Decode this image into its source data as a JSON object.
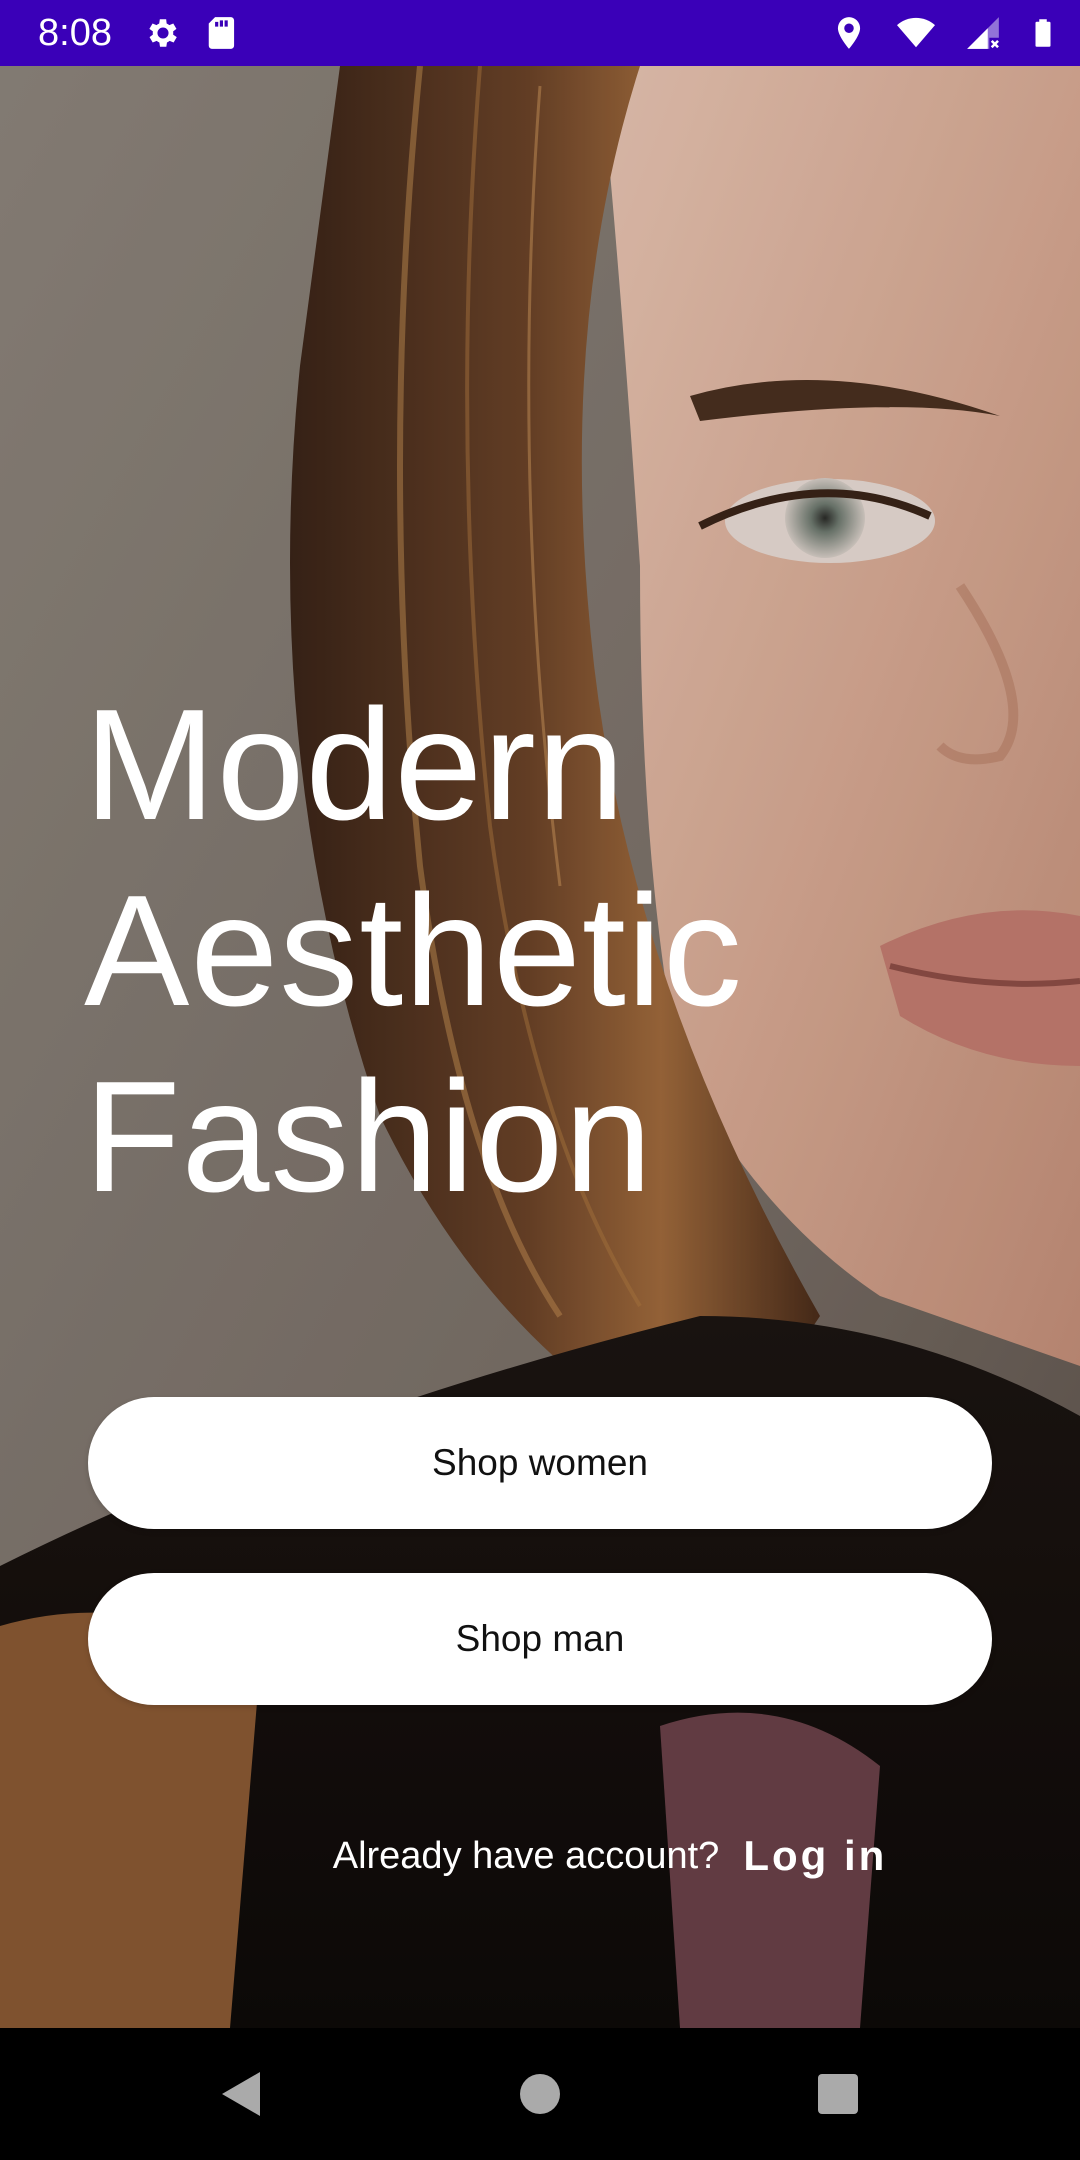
{
  "status_bar": {
    "time": "8:08",
    "left_icons": [
      "gear-icon",
      "sd-card-icon"
    ],
    "right_icons": [
      "location-icon",
      "wifi-icon",
      "cell-signal-icon",
      "battery-icon"
    ],
    "background": "#3a00b8"
  },
  "hero": {
    "headline_lines": [
      "Modern",
      "Aesthetic",
      "Fashion"
    ]
  },
  "buttons": {
    "shop_women": "Shop women",
    "shop_man": "Shop man"
  },
  "login": {
    "question": "Already have account?",
    "link": "Log in"
  },
  "nav_bar": {
    "icons": [
      "back-icon",
      "home-icon",
      "recents-icon"
    ]
  }
}
